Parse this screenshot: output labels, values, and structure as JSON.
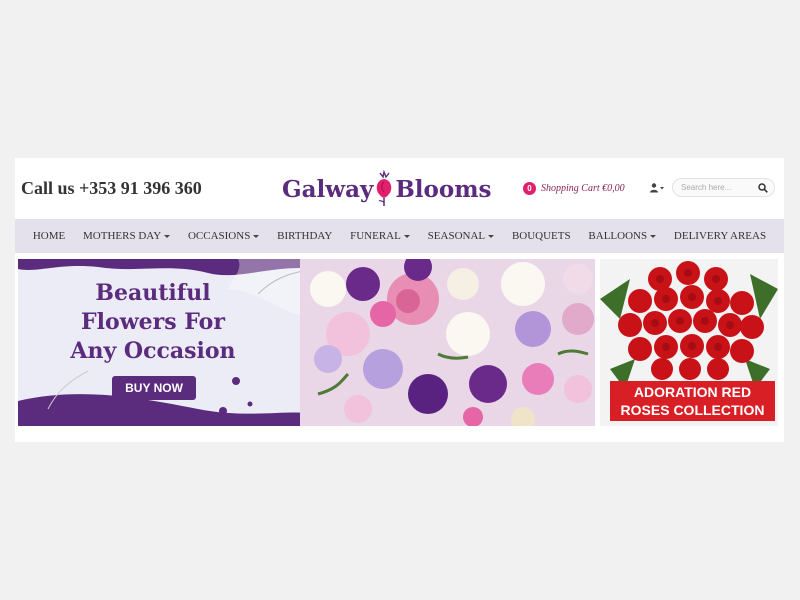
{
  "header": {
    "phone_label": "Call us +353 91 396 360",
    "logo_left": "Galway",
    "logo_right": "Blooms",
    "cart_count": "0",
    "cart_text": "Shopping Cart €0,00",
    "search_placeholder": "Search here...",
    "brand_color": "#5b2b7d",
    "accent_color": "#e0206c"
  },
  "nav": {
    "items": [
      {
        "label": "HOME",
        "dropdown": false
      },
      {
        "label": "MOTHERS DAY",
        "dropdown": true
      },
      {
        "label": "OCCASIONS",
        "dropdown": true
      },
      {
        "label": "BIRTHDAY",
        "dropdown": false
      },
      {
        "label": "FUNERAL",
        "dropdown": true
      },
      {
        "label": "SEASONAL",
        "dropdown": true
      },
      {
        "label": "BOUQUETS",
        "dropdown": false
      },
      {
        "label": "BALLOONS",
        "dropdown": true
      },
      {
        "label": "DELIVERY AREAS",
        "dropdown": false
      }
    ]
  },
  "hero": {
    "title_line1": "Beautiful",
    "title_line2": "Flowers For",
    "title_line3": "Any Occasion",
    "button_label": "BUY NOW"
  },
  "promo": {
    "label_line1": "ADORATION RED",
    "label_line2": "ROSES COLLECTION"
  }
}
